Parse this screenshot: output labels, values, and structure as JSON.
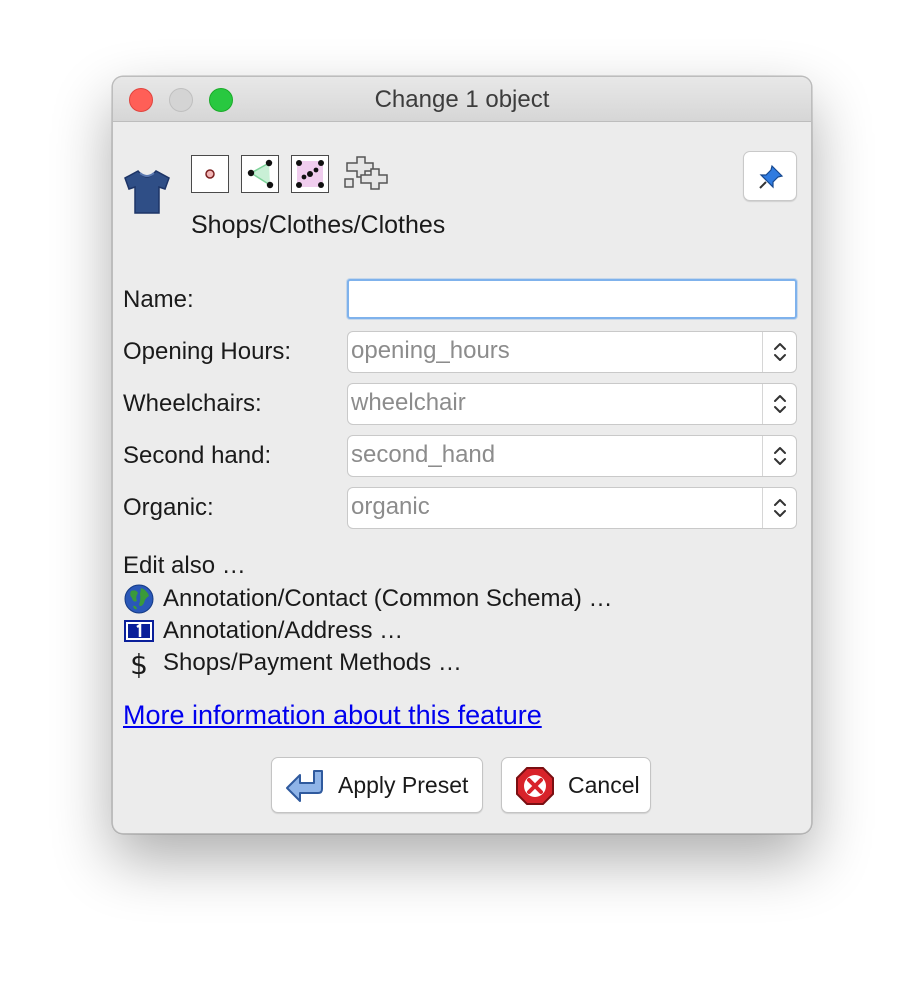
{
  "window": {
    "title": "Change 1 object",
    "buttons": [
      "close",
      "minimize",
      "maximize"
    ]
  },
  "preset": {
    "icon": "t-shirt-icon",
    "path": "Shops/Clothes/Clothes",
    "types": [
      "node-icon",
      "way-icon",
      "closed-way-icon",
      "multipolygon-icon"
    ],
    "pin_icon": "pushpin-icon"
  },
  "fields": {
    "name": {
      "label": "Name:",
      "value": ""
    },
    "opening_hours": {
      "label": "Opening Hours:",
      "placeholder": "opening_hours"
    },
    "wheelchair": {
      "label": "Wheelchairs:",
      "placeholder": "wheelchair"
    },
    "second_hand": {
      "label": "Second hand:",
      "placeholder": "second_hand"
    },
    "organic": {
      "label": "Organic:",
      "placeholder": "organic"
    }
  },
  "edit_also": {
    "heading": "Edit also …",
    "items": [
      {
        "label": "Annotation/Contact (Common Schema) …",
        "icon": "globe-icon"
      },
      {
        "label": "Annotation/Address …",
        "icon": "house-number-icon"
      },
      {
        "label": "Shops/Payment Methods …",
        "icon": "dollar-icon"
      }
    ]
  },
  "more_info_link": "More information about this feature",
  "actions": {
    "apply": "Apply Preset",
    "cancel": "Cancel"
  },
  "colors": {
    "close": "#ff5f57",
    "maximize": "#28c840",
    "link": "#0000ee",
    "focus_ring": "#7fb2ec"
  }
}
